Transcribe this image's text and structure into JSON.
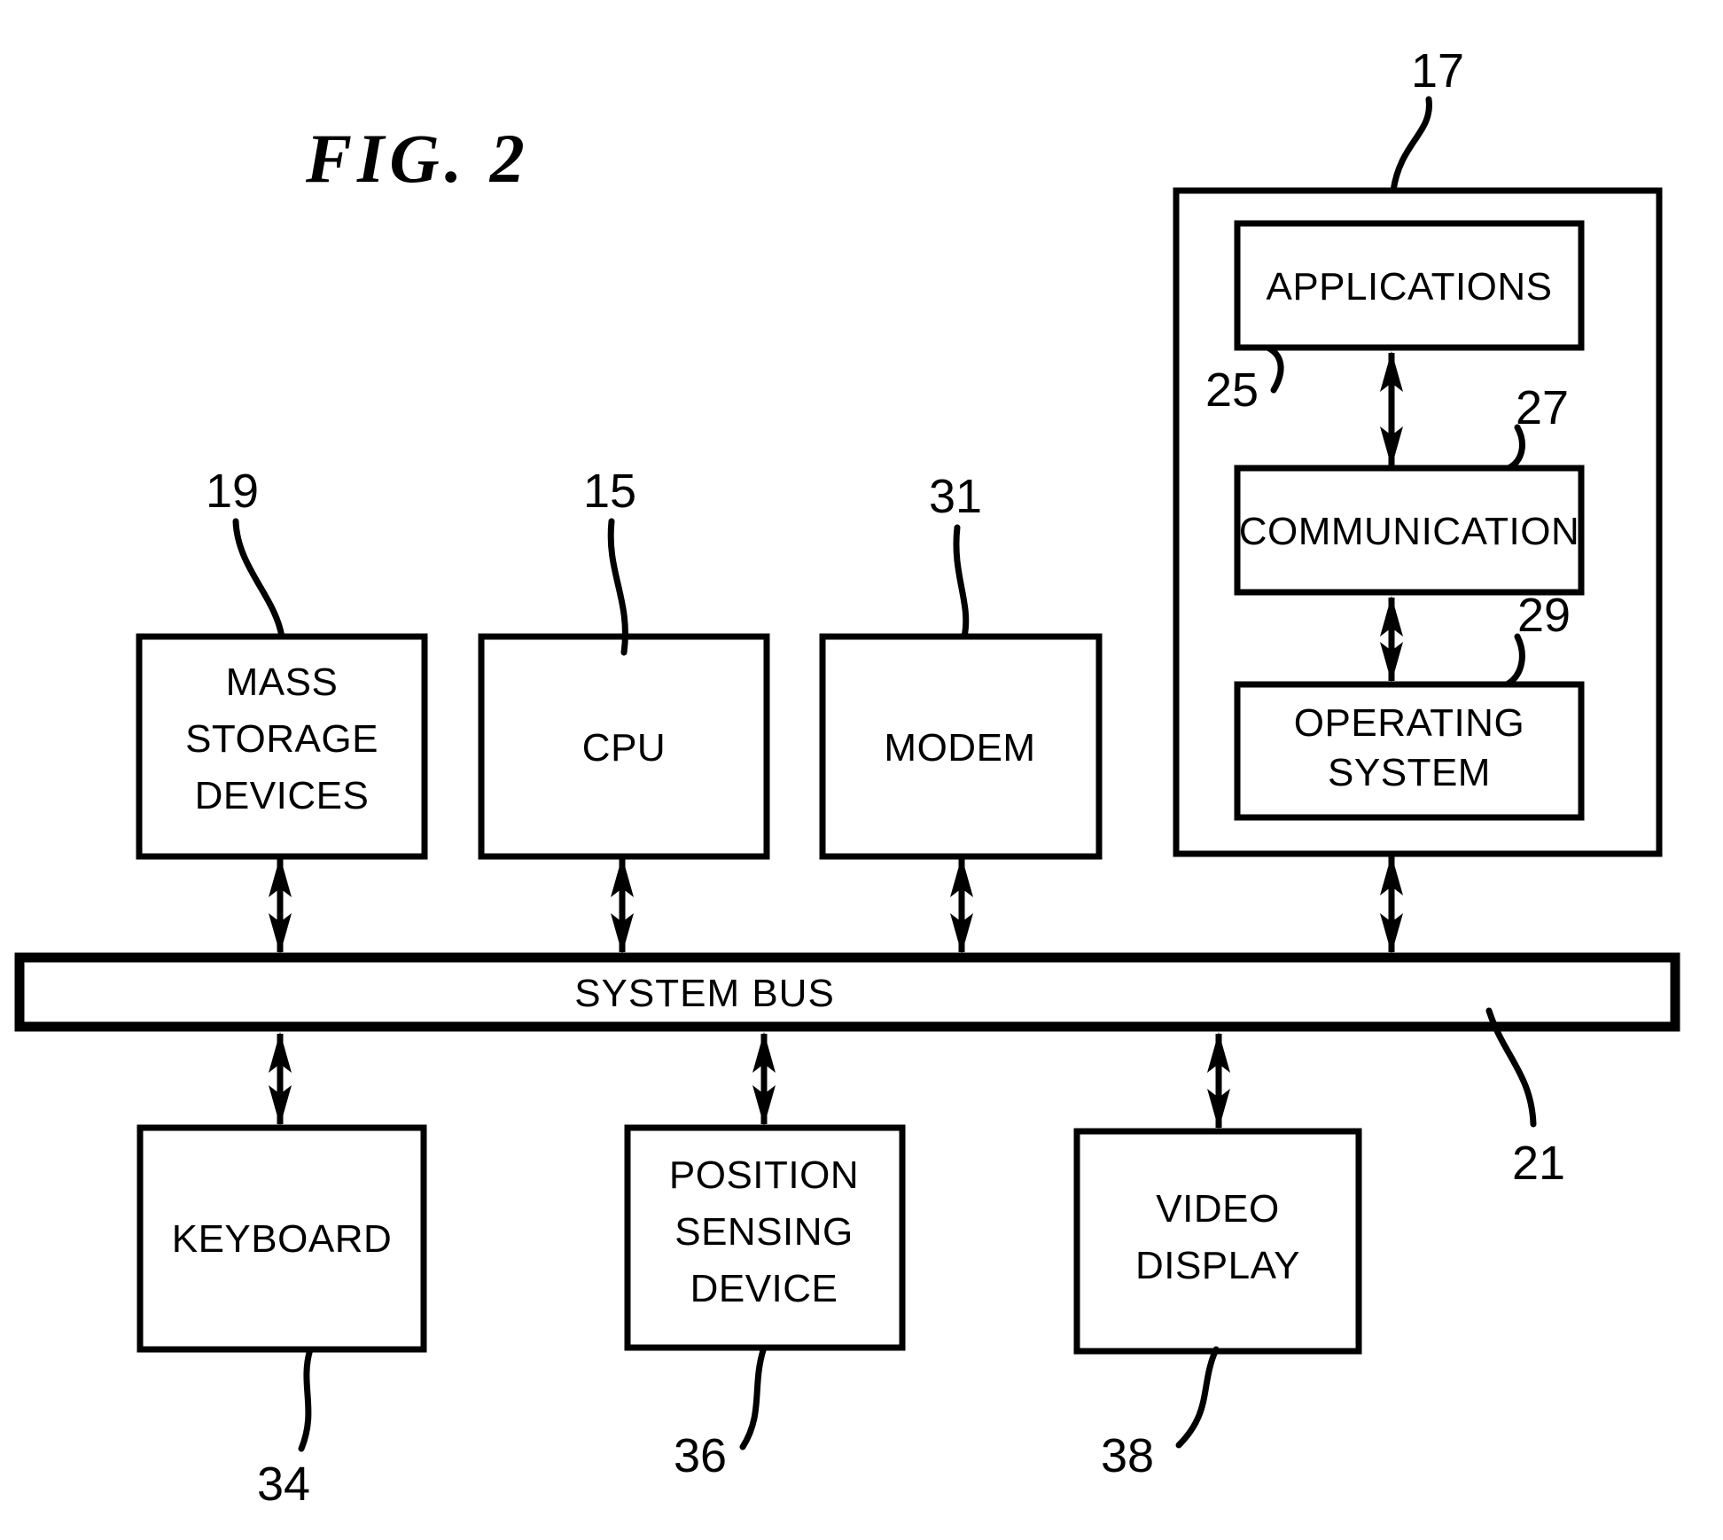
{
  "figure": {
    "title": "FIG.  2",
    "type": "patent-block-diagram",
    "description": "Computer system block diagram"
  },
  "boxes": {
    "mass_storage": {
      "label_line1": "MASS",
      "label_line2": "STORAGE",
      "label_line3": "DEVICES",
      "ref": "19"
    },
    "cpu": {
      "label_line1": "CPU",
      "ref": "15"
    },
    "modem": {
      "label_line1": "MODEM",
      "ref": "31"
    },
    "software_module": {
      "ref": "17"
    },
    "applications": {
      "label_line1": "APPLICATIONS",
      "ref": "25"
    },
    "communication": {
      "label_line1": "COMMUNICATION",
      "ref": "27"
    },
    "operating_system": {
      "label_line1": "OPERATING",
      "label_line2": "SYSTEM",
      "ref": "29"
    },
    "system_bus": {
      "label_line1": "SYSTEM BUS",
      "ref": "21"
    },
    "keyboard": {
      "label_line1": "KEYBOARD",
      "ref": "34"
    },
    "position_sensing": {
      "label_line1": "POSITION",
      "label_line2": "SENSING",
      "label_line3": "DEVICE",
      "ref": "36"
    },
    "video_display": {
      "label_line1": "VIDEO",
      "label_line2": "DISPLAY",
      "ref": "38"
    }
  },
  "colors": {
    "stroke": "#000000",
    "background": "#ffffff"
  }
}
